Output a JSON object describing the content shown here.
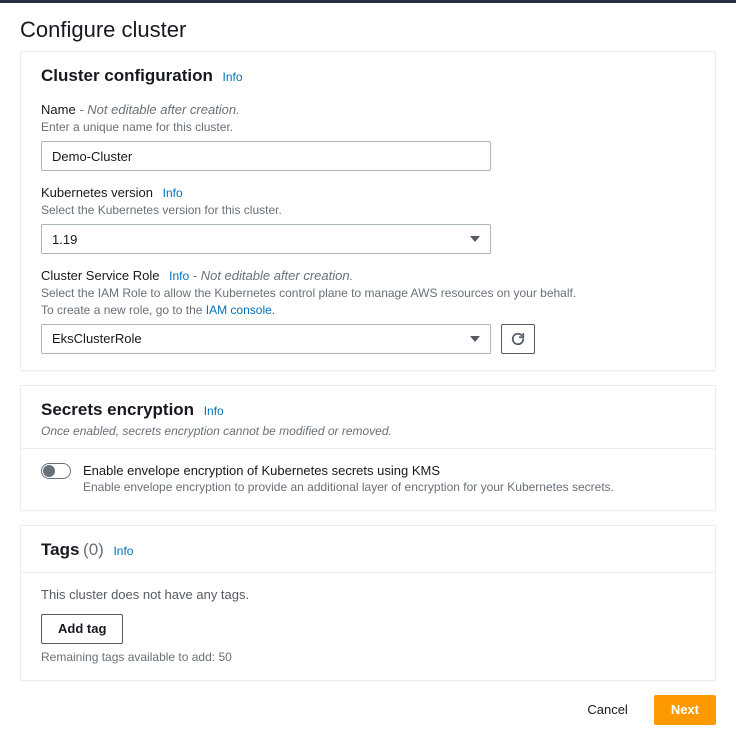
{
  "pageTitle": "Configure cluster",
  "infoLabel": "Info",
  "clusterConfig": {
    "title": "Cluster configuration",
    "name": {
      "label": "Name",
      "note": "Not editable after creation.",
      "help": "Enter a unique name for this cluster.",
      "value": "Demo-Cluster"
    },
    "version": {
      "label": "Kubernetes version",
      "help": "Select the Kubernetes version for this cluster.",
      "value": "1.19"
    },
    "role": {
      "label": "Cluster Service Role",
      "note": "Not editable after creation.",
      "help1": "Select the IAM Role to allow the Kubernetes control plane to manage AWS resources on your behalf.",
      "help2a": "To create a new role, go to the ",
      "help2link": "IAM console.",
      "value": "EksClusterRole"
    }
  },
  "secrets": {
    "title": "Secrets encryption",
    "subtitle": "Once enabled, secrets encryption cannot be modified or removed.",
    "toggleLabel": "Enable envelope encryption of Kubernetes secrets using KMS",
    "toggleHelp": "Enable envelope encryption to provide an additional layer of encryption for your Kubernetes secrets."
  },
  "tags": {
    "title": "Tags",
    "count": "(0)",
    "empty": "This cluster does not have any tags.",
    "addLabel": "Add tag",
    "remaining": "Remaining tags available to add: 50"
  },
  "footer": {
    "cancel": "Cancel",
    "next": "Next"
  }
}
